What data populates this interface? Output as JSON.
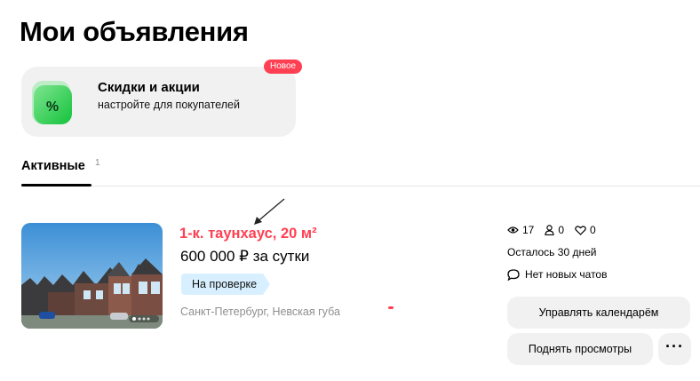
{
  "page": {
    "title": "Мои объявления"
  },
  "promo": {
    "title": "Скидки и акции",
    "subtitle": "настройте для покупателей",
    "badge": "Новое",
    "icon_symbol": "%",
    "accent_color": "#2ecc55"
  },
  "tabs": [
    {
      "label": "Активные",
      "count": "1",
      "active": true
    }
  ],
  "listing": {
    "title": "1-к. таунхаус, 20 м²",
    "price": "600 000 ₽ за сутки",
    "status": "На проверке",
    "address": "Санкт-Петербург, Невская губа",
    "photo_icon": "townhouse-photo",
    "stats": {
      "views": "17",
      "favorites": "0",
      "likes": "0"
    },
    "days_left": "Осталось 30 дней",
    "chats": "Нет новых чатов",
    "buttons": {
      "calendar": "Управлять календарём",
      "boost": "Поднять просмотры",
      "more": "···"
    }
  },
  "colors": {
    "accent": "#ff4053",
    "status_bg": "#d8efff",
    "button_bg": "#f1f1f1"
  }
}
